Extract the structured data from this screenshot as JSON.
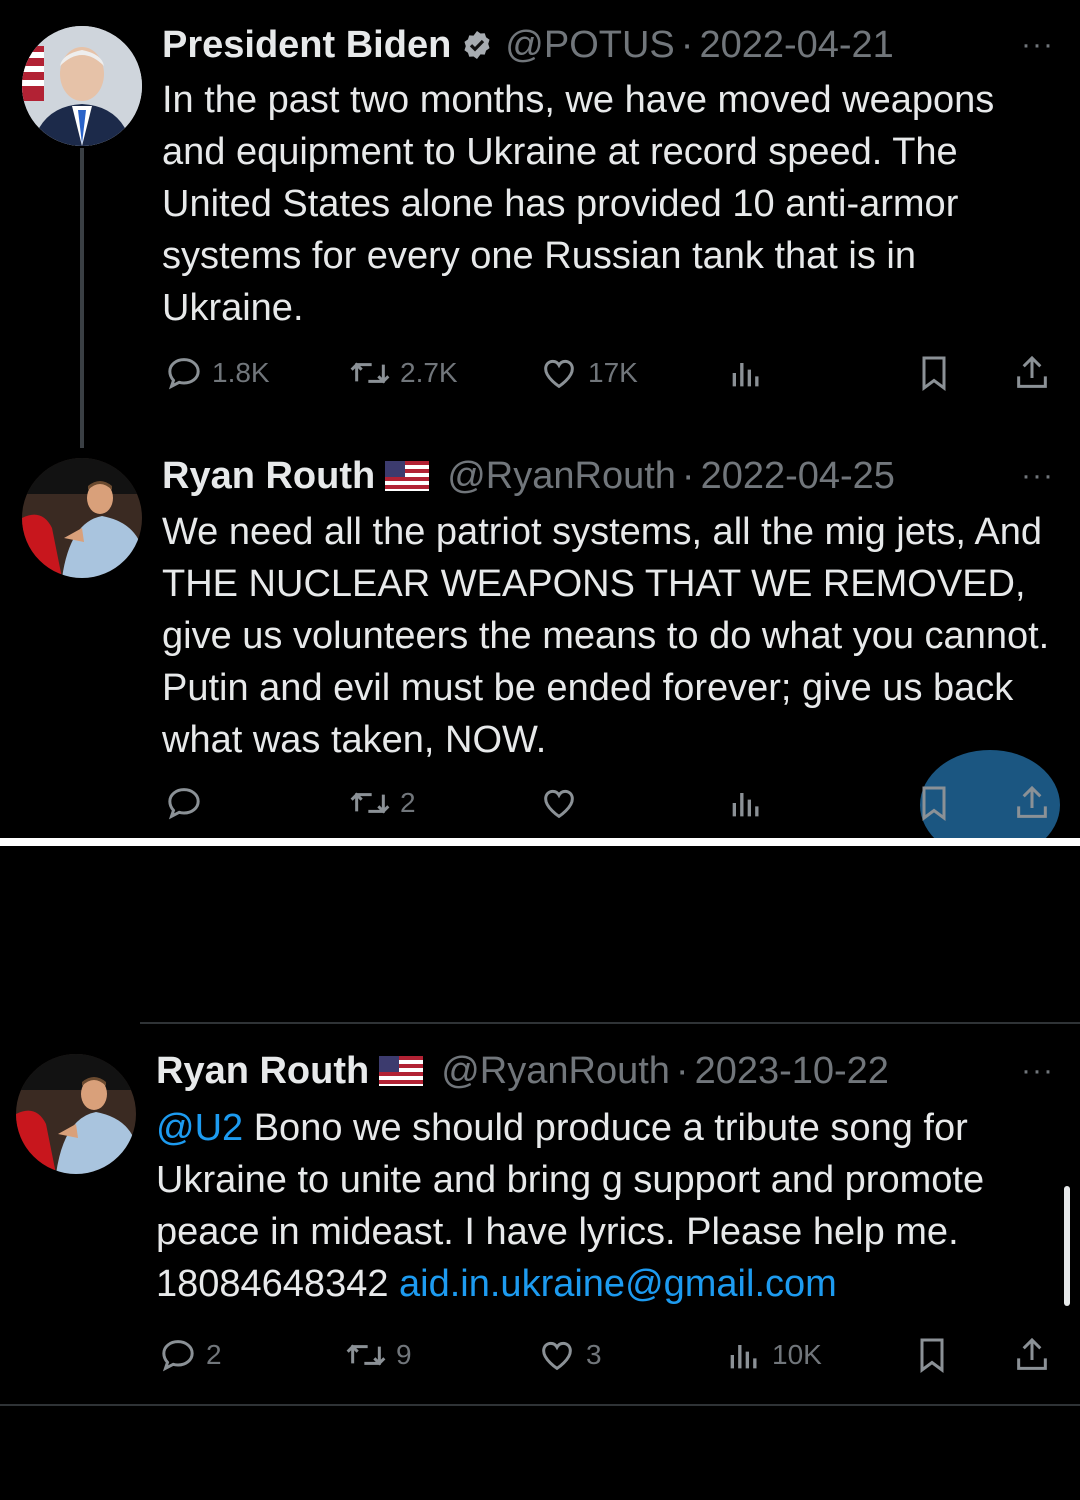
{
  "tweets": [
    {
      "name": "President Biden",
      "handle": "@POTUS",
      "sep": "·",
      "date": "2022-04-21",
      "more": "···",
      "text": "In the past two months, we have moved weapons and equipment to Ukraine at record speed. The United States alone has provided 10 anti-armor systems for every one Russian tank that is in Ukraine.",
      "replies": "1.8K",
      "retweets": "2.7K",
      "likes": "17K",
      "views": ""
    },
    {
      "name": "Ryan Routh",
      "handle": "@RyanRouth",
      "sep": "·",
      "date": "2022-04-25",
      "more": "···",
      "text": "We need all the patriot systems, all the mig jets, And THE NUCLEAR WEAPONS THAT WE REMOVED, give us volunteers the means to do what you cannot. Putin and evil must be ended forever; give us back what was taken, NOW.",
      "replies": "",
      "retweets": "2",
      "likes": "",
      "views": ""
    },
    {
      "name": "Ryan Routh",
      "handle": "@RyanRouth",
      "sep": "·",
      "date": "2023-10-22",
      "more": "···",
      "mention": "@U2",
      "text_main": " Bono we should produce a tribute song for Ukraine to unite and bring g support and promote peace in mideast. I have lyrics. Please help me. 18084648342 ",
      "email": "aid.in.ukraine@gmail.com",
      "replies": "2",
      "retweets": "9",
      "likes": "3",
      "views": "10K"
    }
  ],
  "icons": {
    "reply": "speech-bubble-icon",
    "retweet": "retweet-icon",
    "like": "heart-icon",
    "views": "bar-chart-icon",
    "bookmark": "bookmark-icon",
    "share": "share-icon",
    "verified": "verified-badge-icon",
    "flag": "us-flag-icon"
  },
  "colors": {
    "background": "#000000",
    "text": "#e7e9ea",
    "muted": "#71767b",
    "link": "#1d9bf0"
  }
}
